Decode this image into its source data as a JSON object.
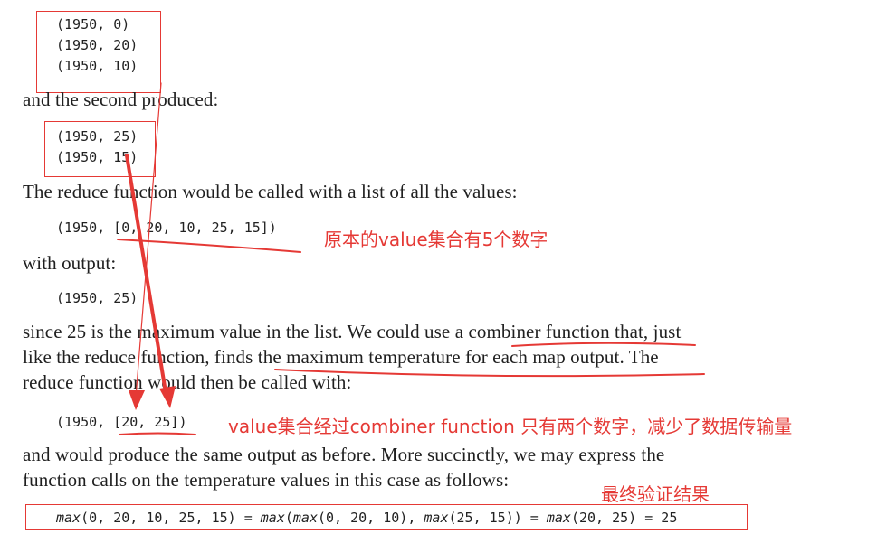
{
  "code_block_1": [
    "(1950, 0)",
    "(1950, 20)",
    "(1950, 10)"
  ],
  "text_second": "and the second produced:",
  "code_block_2": [
    "(1950, 25)",
    "(1950, 15)"
  ],
  "text_reduce_called": "The reduce function would be called with a list of all the values:",
  "code_all_values": "(1950, [0, 20, 10, 25, 15])",
  "note_original": "原本的value集合有5个数字",
  "text_with_output": "with output:",
  "code_output": "(1950, 25)",
  "paragraph_lines": [
    "since 25 is the maximum value in the list. We could use a combiner function that, just",
    "like the reduce function, finds the maximum temperature for each map output. The",
    "reduce function would then be called with:"
  ],
  "code_combined": "(1950, [20, 25])",
  "note_combiner": "value集合经过combiner function 只有两个数字，减少了数据传输量",
  "conclusion_lines": [
    "and would produce the same output as before. More succinctly, we may express the",
    "function calls on the temperature values in this case as follows:"
  ],
  "note_final": "最终验证结果",
  "formula": {
    "fn": "max",
    "p1": "(0, 20, 10, 25, 15) = ",
    "p2": "(",
    "p3": "(0, 20, 10), ",
    "p4": "(25, 15)) = ",
    "p5": "(20, 25) = 25"
  },
  "colors": {
    "annotation": "#e53935",
    "text": "#1f1f1f"
  }
}
